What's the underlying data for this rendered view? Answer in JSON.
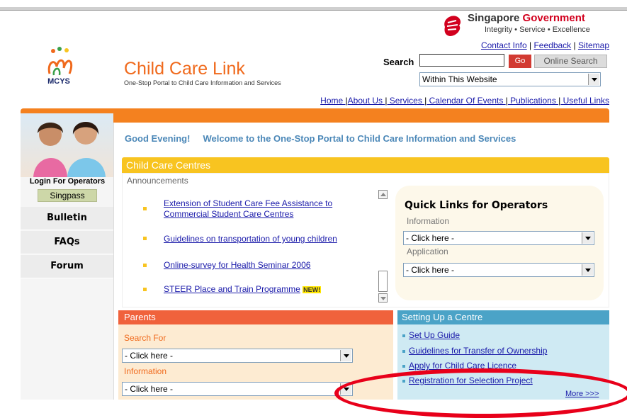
{
  "header": {
    "gov_title_part1": "Singapore",
    "gov_title_part2": "Government",
    "gov_tagline": "Integrity • Service • Excellence",
    "top_links": [
      "Contact Info",
      "Feedback",
      "Sitemap"
    ],
    "logo_text": "MCYS",
    "site_title": "Child Care Link",
    "site_subtitle": "One-Stop  Portal to Child Care Information and Services"
  },
  "search": {
    "label": "Search",
    "value": "",
    "go_label": "Go",
    "online_search_label": "Online Search",
    "scope_selected": "Within This Website"
  },
  "nav": [
    "Home ",
    "About Us ",
    " Services ",
    " Calendar Of Events ",
    " Publications ",
    " Useful Links"
  ],
  "left": {
    "login_label": "Login For Operators",
    "singpass_label": "Singpass",
    "buttons": [
      "Bulletin",
      "FAQs",
      "Forum"
    ]
  },
  "greeting": {
    "salutation": "Good Evening!",
    "welcome": "Welcome to the One-Stop Portal to Child Care Information and Services"
  },
  "centres": {
    "title": "Child Care Centres",
    "announcements_label": "Announcements",
    "items": [
      "Extension of Student Care Fee Assistance to Commercial Student Care Centres",
      "Guidelines on transportation of young children",
      "Online-survey for Health Seminar 2006",
      "STEER Place and Train Programme"
    ],
    "new_badge": "NEW!"
  },
  "quick_links": {
    "title": "Quick Links for Operators",
    "information_label": "Information",
    "information_selected": "- Click here -",
    "application_label": "Application",
    "application_selected": "- Click here -"
  },
  "parents": {
    "title": "Parents",
    "search_for_label": "Search For",
    "search_for_selected": "- Click here -",
    "information_label": "Information",
    "information_selected": "- Click here -"
  },
  "setup": {
    "title": "Setting Up a Centre",
    "links": [
      "Set Up Guide",
      "Guidelines for Transfer of Ownership",
      "Apply for Child Care Licence",
      "Registration for Selection Project"
    ],
    "more_label": "More >>>"
  },
  "colors": {
    "orange": "#f4811f",
    "yellow": "#f8c420",
    "parents_red": "#f0623c",
    "setup_blue": "#4ba3c7",
    "link_blue": "#1a1aaa",
    "annotation_red": "#e8001a"
  }
}
